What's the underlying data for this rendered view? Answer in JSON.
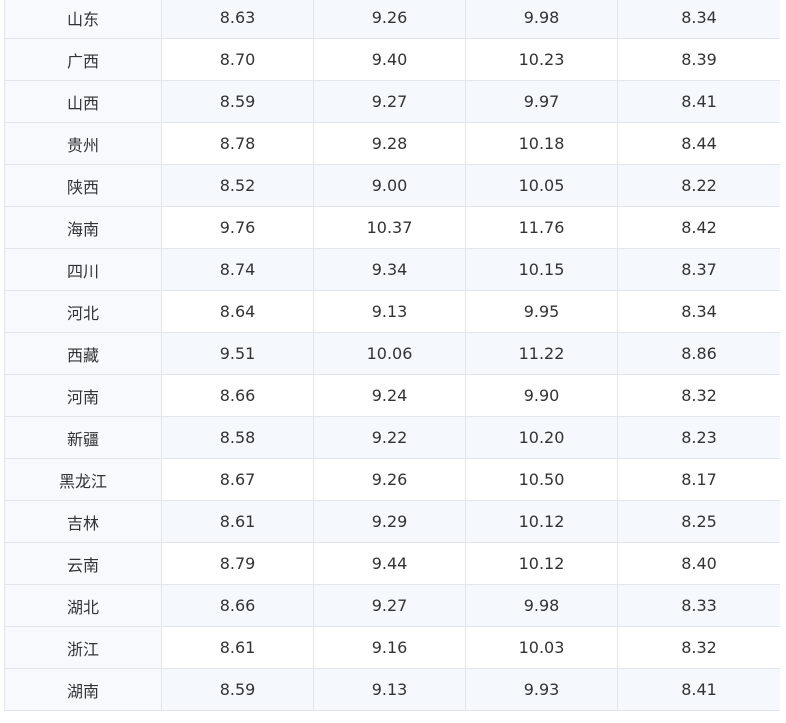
{
  "table": {
    "rows": [
      [
        "山东",
        "8.63",
        "9.26",
        "9.98",
        "8.34"
      ],
      [
        "广西",
        "8.70",
        "9.40",
        "10.23",
        "8.39"
      ],
      [
        "山西",
        "8.59",
        "9.27",
        "9.97",
        "8.41"
      ],
      [
        "贵州",
        "8.78",
        "9.28",
        "10.18",
        "8.44"
      ],
      [
        "陕西",
        "8.52",
        "9.00",
        "10.05",
        "8.22"
      ],
      [
        "海南",
        "9.76",
        "10.37",
        "11.76",
        "8.42"
      ],
      [
        "四川",
        "8.74",
        "9.34",
        "10.15",
        "8.37"
      ],
      [
        "河北",
        "8.64",
        "9.13",
        "9.95",
        "8.34"
      ],
      [
        "西藏",
        "9.51",
        "10.06",
        "11.22",
        "8.86"
      ],
      [
        "河南",
        "8.66",
        "9.24",
        "9.90",
        "8.32"
      ],
      [
        "新疆",
        "8.58",
        "9.22",
        "10.20",
        "8.23"
      ],
      [
        "黑龙江",
        "8.67",
        "9.26",
        "10.50",
        "8.17"
      ],
      [
        "吉林",
        "8.61",
        "9.29",
        "10.12",
        "8.25"
      ],
      [
        "云南",
        "8.79",
        "9.44",
        "10.12",
        "8.40"
      ],
      [
        "湖北",
        "8.66",
        "9.27",
        "9.98",
        "8.33"
      ],
      [
        "浙江",
        "8.61",
        "9.16",
        "10.03",
        "8.32"
      ],
      [
        "湖南",
        "8.59",
        "9.13",
        "9.93",
        "8.41"
      ]
    ]
  }
}
